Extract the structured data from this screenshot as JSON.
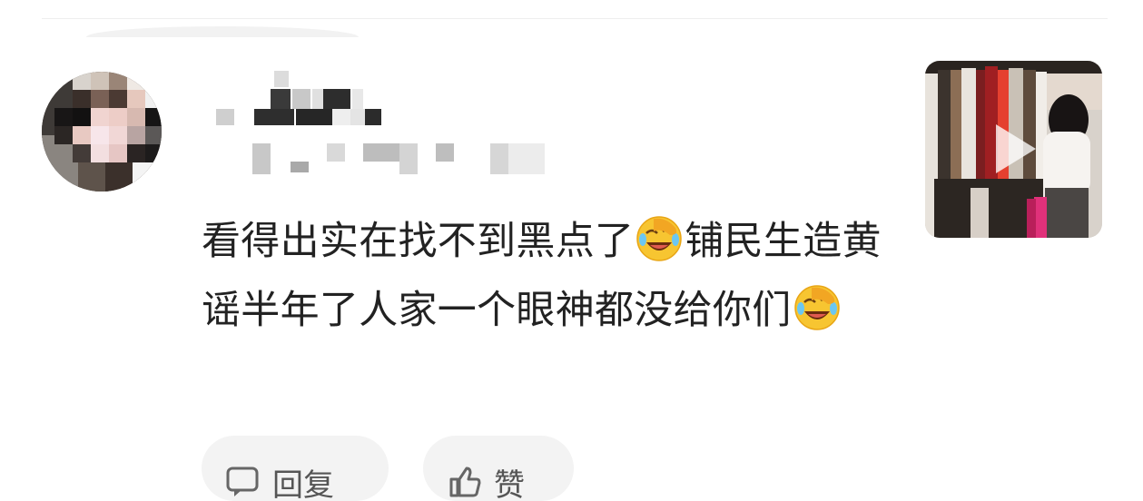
{
  "comment": {
    "text_part1": "看得出实在找不到黑点了",
    "emoji_1": "face-palm-laugh-emoji",
    "text_part2": "铺民生造黄谣半年了人家一个眼神都没给你们",
    "emoji_2": "face-palm-laugh-emoji"
  },
  "actions": {
    "reply_label": "回复",
    "like_label": "赞"
  },
  "icons": {
    "avatar": "blurred-avatar",
    "media": "video-thumbnail",
    "play": "play-icon",
    "reply": "reply-icon",
    "like": "thumbs-up-icon"
  },
  "colors": {
    "text": "#222222",
    "button_bg": "#f3f3f3",
    "emoji_yellow": "#f7c531"
  }
}
